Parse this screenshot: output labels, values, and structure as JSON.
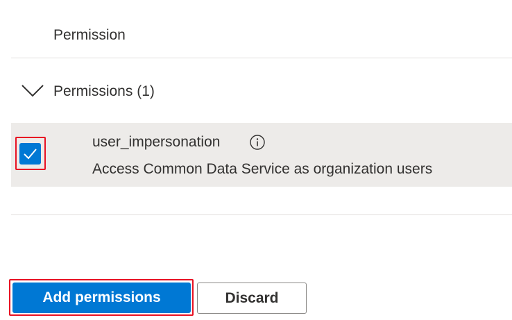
{
  "table": {
    "column_header": "Permission"
  },
  "group": {
    "title": "Permissions (1)",
    "expanded": true,
    "icon": "chevron-down-icon"
  },
  "permissions": [
    {
      "name": "user_impersonation",
      "description": "Access Common Data Service as organization users",
      "checked": true,
      "icon": "info-icon"
    }
  ],
  "actions": {
    "add_label": "Add permissions",
    "discard_label": "Discard"
  },
  "colors": {
    "accent": "#0078d4",
    "row_background": "#edebe9",
    "highlight_border": "#e81123",
    "text": "#323130"
  }
}
